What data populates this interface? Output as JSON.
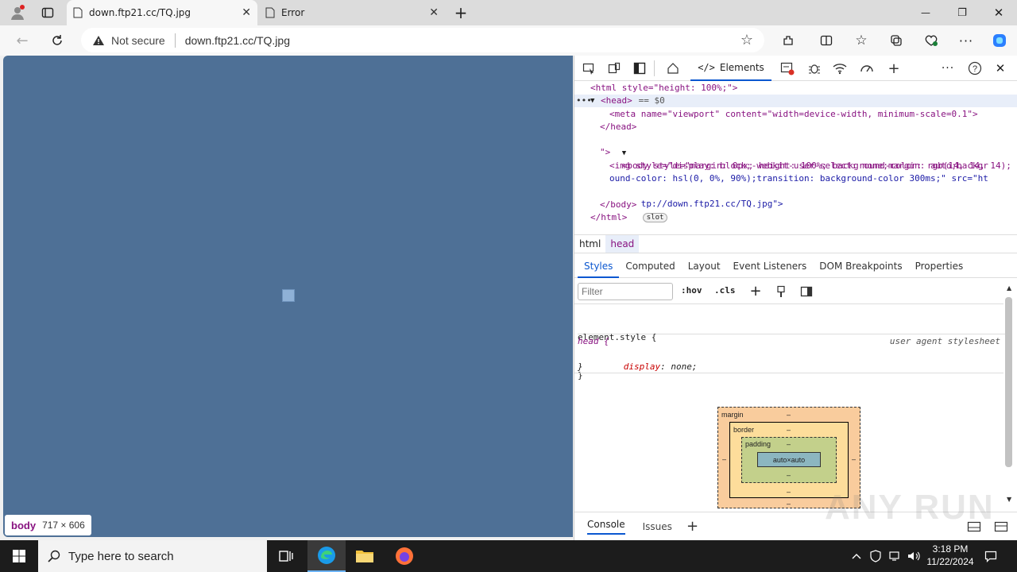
{
  "browser": {
    "tabs": [
      {
        "title": "down.ftp21.cc/TQ.jpg",
        "close": "✕"
      },
      {
        "title": "Error",
        "close": "✕"
      }
    ],
    "new_tab": "+",
    "window_controls": {
      "minimize": "—",
      "maximize": "❐",
      "close": "✕"
    },
    "security_label": "Not secure",
    "url": "down.ftp21.cc/TQ.jpg"
  },
  "viewport": {
    "badge_tag": "body",
    "badge_size": "717 × 606"
  },
  "devtools": {
    "elements_tab": "Elements",
    "dom": {
      "line1": "<html style=\"height: 100%;\">",
      "line2_dots": "•••",
      "line2": "<head>",
      "line2_eq": " == $0",
      "line3": "<meta name=\"viewport\" content=\"width=device-width, minimum-scale=0.1\">",
      "line4": "</head>",
      "line5": "<body style=\"margin: 0px; height: 100%; background-color: rgb(14, 14, 14);",
      "line6": "\">",
      "line7": "<img style=\"display: block;-webkit-user-select: none;margin: auto;backgr",
      "line8": "ound-color: hsl(0, 0%, 90%);transition: background-color 300ms;\" src=\"ht",
      "line9": "tp://down.ftp21.cc/TQ.jpg\">",
      "slot_badge": "slot",
      "line10": "</body>",
      "line11": "</html>"
    },
    "breadcrumbs": [
      "html",
      "head"
    ],
    "subtabs": [
      "Styles",
      "Computed",
      "Layout",
      "Event Listeners",
      "DOM Breakpoints",
      "Properties"
    ],
    "filter_placeholder": "Filter",
    "hov": ":hov",
    "cls": ".cls",
    "element_style_open": "element.style {",
    "element_style_close": "}",
    "rule_selector": "head {",
    "rule_source": "user agent stylesheet",
    "rule_prop": "display",
    "rule_val": "none;",
    "rule_close": "}",
    "boxmodel": {
      "margin": "margin",
      "border": "border",
      "padding": "padding",
      "content": "auto×auto",
      "dash": "–"
    },
    "drawer_tabs": [
      "Console",
      "Issues"
    ],
    "drawer_add": "+"
  },
  "watermark": "ANY RUN",
  "taskbar": {
    "search_placeholder": "Type here to search",
    "time": "3:18 PM",
    "date": "11/22/2024"
  },
  "colors": {
    "viewport_bg": "#4e7096",
    "accent": "#0b57d0",
    "taskbar": "#1c1c1c"
  }
}
